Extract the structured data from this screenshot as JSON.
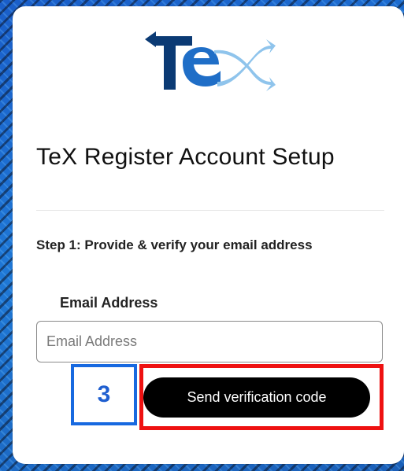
{
  "logo": {
    "alt": "TeX logo",
    "letters": "TeX",
    "colors": {
      "navy": "#0b3a74",
      "blue": "#1f6ec7",
      "light": "#8fc4ec"
    }
  },
  "page": {
    "title": "TeX Register Account Setup",
    "step_text": "Step 1: Provide & verify your email address"
  },
  "email": {
    "label": "Email Address",
    "placeholder": "Email Address",
    "value": ""
  },
  "actions": {
    "send_code_label": "Send verification code"
  },
  "annotation": {
    "number": "3",
    "box_color": "#1769e0",
    "highlight_color": "#ee1111"
  }
}
